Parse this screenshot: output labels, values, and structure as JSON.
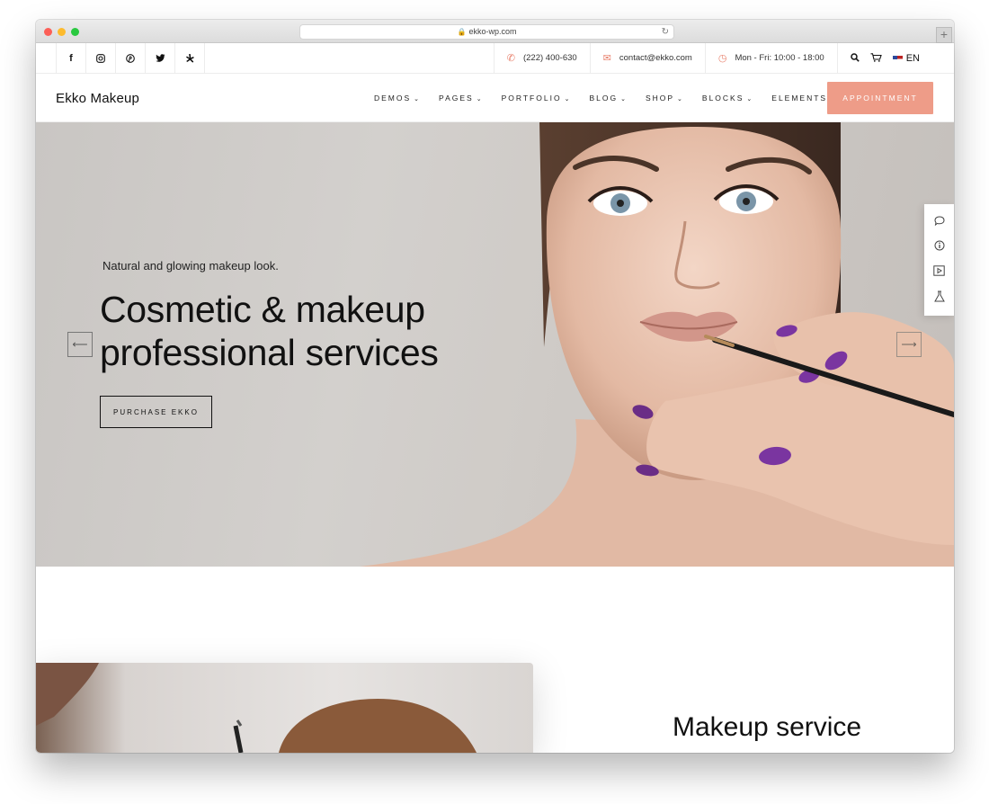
{
  "browser": {
    "url": "ekko-wp.com"
  },
  "topbar": {
    "social": [
      {
        "icon": "facebook-icon",
        "glyph": "f"
      },
      {
        "icon": "instagram-icon",
        "glyph": "◎"
      },
      {
        "icon": "pinterest-icon",
        "glyph": "℗"
      },
      {
        "icon": "twitter-icon",
        "glyph": "🐦"
      },
      {
        "icon": "yelp-icon",
        "glyph": "✱"
      }
    ],
    "phone": "(222) 400-630",
    "email": "contact@ekko.com",
    "hours": "Mon - Fri: 10:00 - 18:00",
    "language": "EN"
  },
  "header": {
    "logo": "Ekko Makeup",
    "nav": [
      "DEMOS",
      "PAGES",
      "PORTFOLIO",
      "BLOG",
      "SHOP",
      "BLOCKS",
      "ELEMENTS"
    ],
    "cta": "APPOINTMENT"
  },
  "hero": {
    "subtitle": "Natural and glowing makeup look.",
    "title_line1": "Cosmetic & makeup",
    "title_line2": "professional services",
    "button": "PURCHASE EKKO"
  },
  "sidepanel": {
    "icons": [
      "chat-icon",
      "info-icon",
      "video-icon",
      "flask-icon"
    ]
  },
  "section": {
    "title": "Makeup service"
  },
  "colors": {
    "accent": "#ee9c88",
    "icon_accent": "#e8806c",
    "hero_bg": "#cfcbc7"
  }
}
